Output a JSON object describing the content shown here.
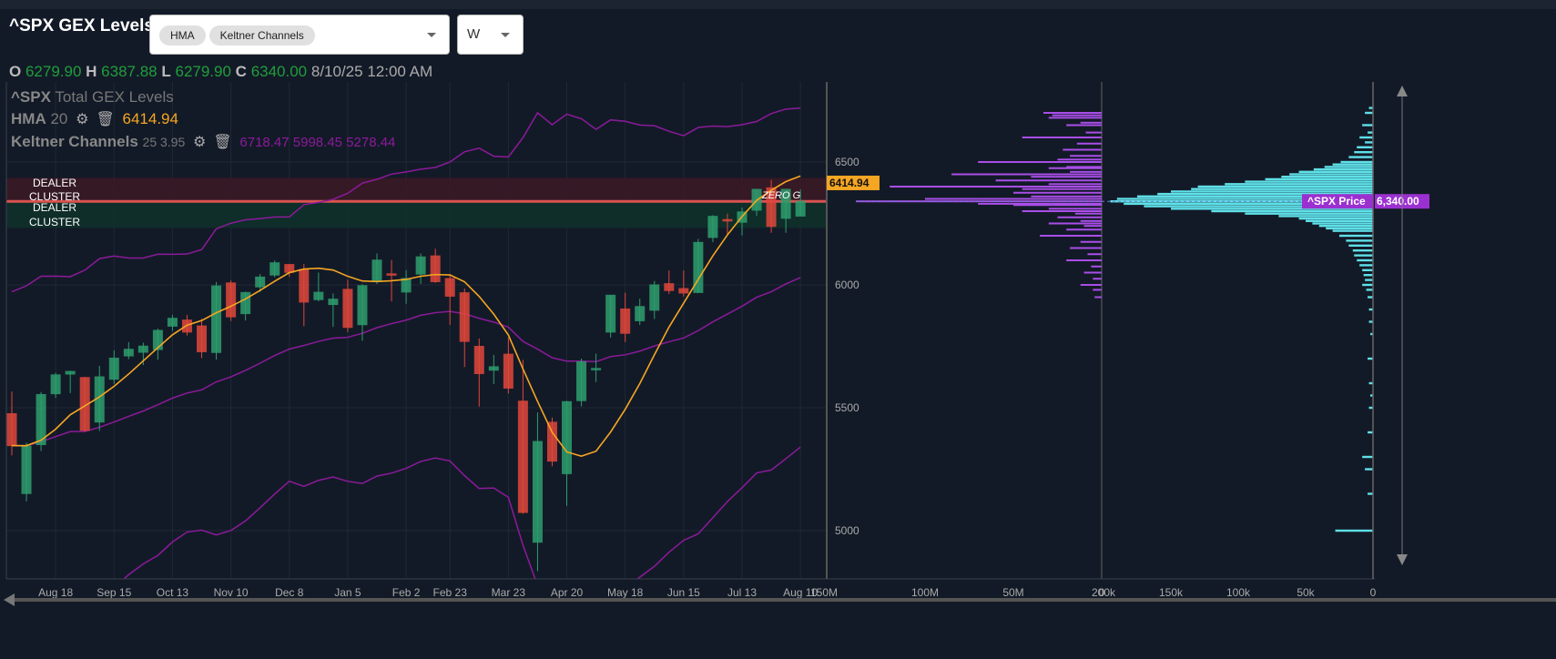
{
  "title": "^SPX GEX Levels",
  "indicator_select": {
    "chips": [
      "HMA",
      "Keltner Channels"
    ]
  },
  "timeframe_select": {
    "value": "W"
  },
  "ohlc": {
    "o_label": "O",
    "o": "6279.90",
    "h_label": "H",
    "h": "6387.88",
    "l_label": "L",
    "l": "6279.90",
    "c_label": "C",
    "c": "6340.00",
    "date": "8/10/25 12:00 AM"
  },
  "legend": {
    "series": {
      "sym": "^SPX",
      "label": "Total GEX Levels"
    },
    "hma": {
      "name": "HMA",
      "params": "20",
      "value": "6414.94"
    },
    "keltner": {
      "name": "Keltner Channels",
      "params": "25 3.95",
      "values": "6718.47 5998.45 5278.44"
    }
  },
  "colors": {
    "up": "#2e9e6e",
    "down": "#e0473b",
    "hma": "#f5a623",
    "keltner": "#8b1a9b",
    "gex": "#a94ee8",
    "profile": "#5fe0e8",
    "price_tag": "#9b30d0",
    "hma_tag": "#f5a623"
  },
  "annotations": {
    "dealer_upper": "DEALER CLUSTER",
    "dealer_lower": "DEALER CLUSTER",
    "zero_g": "ZERO G"
  },
  "price_tag": {
    "label": "^SPX Price",
    "value": "6,340.00"
  },
  "hma_tag": "6414.94",
  "chart_data": {
    "type": "candlestick",
    "price_axis": {
      "ticks": [
        5000,
        5500,
        6000,
        6500
      ],
      "range": [
        4880,
        6780
      ]
    },
    "x_ticks": [
      {
        "i": 3,
        "label": "Aug 18"
      },
      {
        "i": 7,
        "label": "Sep 15"
      },
      {
        "i": 11,
        "label": "Oct 13"
      },
      {
        "i": 15,
        "label": "Nov 10"
      },
      {
        "i": 19,
        "label": "Dec 8"
      },
      {
        "i": 23,
        "label": "Jan 5"
      },
      {
        "i": 27,
        "label": "Feb 2"
      },
      {
        "i": 30,
        "label": "Feb 23"
      },
      {
        "i": 34,
        "label": "Mar 23"
      },
      {
        "i": 38,
        "label": "Apr 20"
      },
      {
        "i": 42,
        "label": "May 18"
      },
      {
        "i": 46,
        "label": "Jun 15"
      },
      {
        "i": 50,
        "label": "Jul 13"
      },
      {
        "i": 54,
        "label": "Aug 10"
      }
    ],
    "candles": [
      [
        5476,
        5566,
        5306,
        5346
      ],
      [
        5151,
        5358,
        5119,
        5344
      ],
      [
        5350,
        5564,
        5324,
        5554
      ],
      [
        5557,
        5643,
        5540,
        5634
      ],
      [
        5637,
        5651,
        5560,
        5648
      ],
      [
        5623,
        5626,
        5402,
        5408
      ],
      [
        5442,
        5670,
        5406,
        5626
      ],
      [
        5616,
        5734,
        5597,
        5702
      ],
      [
        5711,
        5767,
        5698,
        5738
      ],
      [
        5726,
        5765,
        5674,
        5751
      ],
      [
        5737,
        5822,
        5696,
        5815
      ],
      [
        5832,
        5878,
        5813,
        5864
      ],
      [
        5857,
        5878,
        5794,
        5808
      ],
      [
        5833,
        5862,
        5702,
        5728
      ],
      [
        5725,
        6012,
        5696,
        5996
      ],
      [
        6008,
        6018,
        5853,
        5870
      ],
      [
        5883,
        5972,
        5855,
        5969
      ],
      [
        5992,
        6044,
        5972,
        6032
      ],
      [
        6040,
        6099,
        6031,
        6090
      ],
      [
        6083,
        6085,
        6033,
        6051
      ],
      [
        6063,
        6085,
        5832,
        5930
      ],
      [
        5940,
        6050,
        5933,
        5970
      ],
      [
        5920,
        5965,
        5829,
        5942
      ],
      [
        5982,
        6021,
        5808,
        5827
      ],
      [
        5838,
        6003,
        5773,
        5997
      ],
      [
        6015,
        6128,
        6004,
        6101
      ],
      [
        6045,
        6101,
        5933,
        6040
      ],
      [
        5971,
        6060,
        5923,
        6026
      ],
      [
        6044,
        6128,
        6004,
        6114
      ],
      [
        6118,
        6147,
        6008,
        6013
      ],
      [
        6026,
        6044,
        5837,
        5954
      ],
      [
        5968,
        5986,
        5666,
        5770
      ],
      [
        5750,
        5782,
        5505,
        5639
      ],
      [
        5653,
        5715,
        5597,
        5667
      ],
      [
        5718,
        5786,
        5558,
        5580
      ],
      [
        5527,
        5695,
        5069,
        5074
      ],
      [
        4953,
        5481,
        4835,
        5363
      ],
      [
        5441,
        5460,
        5262,
        5283
      ],
      [
        5232,
        5528,
        5101,
        5525
      ],
      [
        5529,
        5700,
        5506,
        5687
      ],
      [
        5655,
        5720,
        5605,
        5660
      ],
      [
        5808,
        5958,
        5786,
        5958
      ],
      [
        5902,
        5968,
        5767,
        5803
      ],
      [
        5854,
        5944,
        5837,
        5912
      ],
      [
        5897,
        6016,
        5861,
        6000
      ],
      [
        6005,
        6059,
        5963,
        5977
      ],
      [
        5985,
        6059,
        5952,
        5967
      ],
      [
        5969,
        6187,
        5967,
        6173
      ],
      [
        6193,
        6284,
        6174,
        6279
      ],
      [
        6266,
        6290,
        6201,
        6260
      ],
      [
        6255,
        6315,
        6201,
        6297
      ],
      [
        6304,
        6390,
        6281,
        6389
      ],
      [
        6395,
        6427,
        6212,
        6238
      ],
      [
        6271,
        6350,
        6212,
        6389
      ],
      [
        6280,
        6388,
        6280,
        6340
      ]
    ],
    "dealer_clusters": [
      {
        "from": 6340,
        "to": 6435,
        "color": "#3a1a26"
      },
      {
        "from": 6232,
        "to": 6340,
        "color": "#10302a"
      }
    ],
    "zero_gamma": 6340,
    "gex_axis": {
      "ticks": [
        "150M",
        "100M",
        "50M",
        "0"
      ],
      "max": 150
    },
    "gex_bars": [
      [
        6700,
        33
      ],
      [
        6690,
        28
      ],
      [
        6680,
        30
      ],
      [
        6660,
        12
      ],
      [
        6650,
        20
      ],
      [
        6620,
        9
      ],
      [
        6600,
        45
      ],
      [
        6575,
        14
      ],
      [
        6550,
        22
      ],
      [
        6525,
        18
      ],
      [
        6510,
        25
      ],
      [
        6500,
        70
      ],
      [
        6480,
        20
      ],
      [
        6475,
        30
      ],
      [
        6460,
        18
      ],
      [
        6450,
        85
      ],
      [
        6440,
        40
      ],
      [
        6425,
        60
      ],
      [
        6410,
        30
      ],
      [
        6400,
        120
      ],
      [
        6390,
        45
      ],
      [
        6375,
        50
      ],
      [
        6360,
        40
      ],
      [
        6350,
        100
      ],
      [
        6340,
        139
      ],
      [
        6330,
        70
      ],
      [
        6325,
        50
      ],
      [
        6310,
        30
      ],
      [
        6300,
        45
      ],
      [
        6290,
        15
      ],
      [
        6275,
        25
      ],
      [
        6260,
        12
      ],
      [
        6250,
        30
      ],
      [
        6240,
        10
      ],
      [
        6225,
        20
      ],
      [
        6200,
        35
      ],
      [
        6175,
        12
      ],
      [
        6150,
        18
      ],
      [
        6125,
        8
      ],
      [
        6100,
        20
      ],
      [
        6075,
        6
      ],
      [
        6050,
        10
      ],
      [
        6025,
        5
      ],
      [
        6000,
        12
      ],
      [
        5980,
        5
      ],
      [
        5950,
        4
      ]
    ],
    "profile_axis": {
      "ticks": [
        "200k",
        "150k",
        "100k",
        "50k",
        "0"
      ],
      "max": 200
    },
    "profile_bars": [
      [
        6720,
        3
      ],
      [
        6700,
        6
      ],
      [
        6650,
        8
      ],
      [
        6620,
        4
      ],
      [
        6600,
        10
      ],
      [
        6580,
        6
      ],
      [
        6560,
        12
      ],
      [
        6540,
        14
      ],
      [
        6520,
        18
      ],
      [
        6500,
        24
      ],
      [
        6490,
        30
      ],
      [
        6480,
        36
      ],
      [
        6470,
        44
      ],
      [
        6460,
        55
      ],
      [
        6450,
        62
      ],
      [
        6440,
        68
      ],
      [
        6430,
        80
      ],
      [
        6420,
        95
      ],
      [
        6410,
        110
      ],
      [
        6400,
        130
      ],
      [
        6390,
        135
      ],
      [
        6380,
        150
      ],
      [
        6370,
        160
      ],
      [
        6360,
        175
      ],
      [
        6350,
        190
      ],
      [
        6340,
        195
      ],
      [
        6330,
        185
      ],
      [
        6320,
        170
      ],
      [
        6310,
        150
      ],
      [
        6300,
        120
      ],
      [
        6290,
        95
      ],
      [
        6280,
        70
      ],
      [
        6270,
        55
      ],
      [
        6260,
        50
      ],
      [
        6250,
        45
      ],
      [
        6240,
        40
      ],
      [
        6230,
        35
      ],
      [
        6220,
        30
      ],
      [
        6200,
        25
      ],
      [
        6180,
        20
      ],
      [
        6160,
        18
      ],
      [
        6140,
        15
      ],
      [
        6120,
        14
      ],
      [
        6100,
        12
      ],
      [
        6080,
        10
      ],
      [
        6060,
        8
      ],
      [
        6040,
        7
      ],
      [
        6020,
        6
      ],
      [
        6000,
        8
      ],
      [
        5980,
        5
      ],
      [
        5950,
        4
      ],
      [
        5900,
        3
      ],
      [
        5850,
        3
      ],
      [
        5800,
        2
      ],
      [
        5700,
        4
      ],
      [
        5600,
        3
      ],
      [
        5550,
        2
      ],
      [
        5500,
        3
      ],
      [
        5400,
        4
      ],
      [
        5300,
        8
      ],
      [
        5250,
        6
      ],
      [
        5150,
        4
      ],
      [
        5000,
        28
      ]
    ]
  }
}
